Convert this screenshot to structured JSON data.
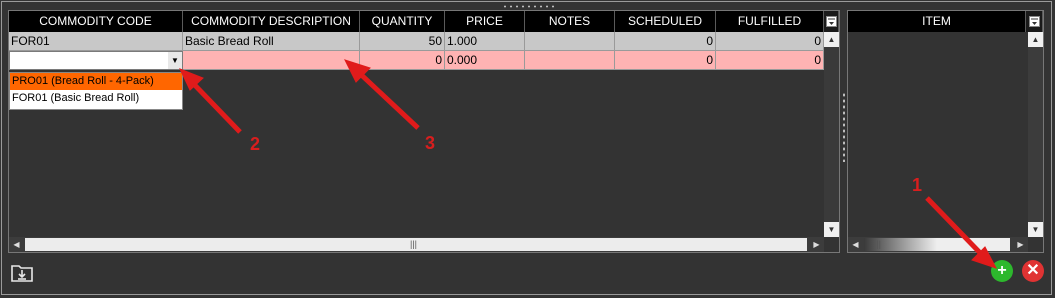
{
  "main_grid": {
    "columns": [
      "COMMODITY CODE",
      "COMMODITY DESCRIPTION",
      "QUANTITY",
      "PRICE",
      "NOTES",
      "SCHEDULED",
      "FULFILLED"
    ],
    "rows": [
      {
        "code": "FOR01",
        "description": "Basic Bread Roll",
        "quantity": "50",
        "price": "1.000",
        "notes": "",
        "scheduled": "0",
        "fulfilled": "0"
      },
      {
        "code": "",
        "description": "",
        "quantity": "0",
        "price": "0.000",
        "notes": "",
        "scheduled": "0",
        "fulfilled": "0"
      }
    ],
    "dropdown_options": [
      "PRO01 (Bread Roll - 4-Pack)",
      "FOR01 (Basic Bread Roll)"
    ],
    "selected_option_index": 0
  },
  "side_grid": {
    "columns": [
      "ITEM"
    ]
  },
  "annotations": [
    "1",
    "2",
    "3"
  ],
  "colors": {
    "header": "#000000",
    "row_normal": "#c8c8c8",
    "row_new": "#ffb3b3",
    "dropdown_selected": "#ff6600",
    "arrow": "#e01b1b",
    "add_button": "#2db82d",
    "cancel_button": "#e03333"
  },
  "icons": {
    "column_chooser": "column-chooser-icon",
    "export": "export-icon",
    "add": "plus-icon",
    "cancel": "close-icon"
  }
}
